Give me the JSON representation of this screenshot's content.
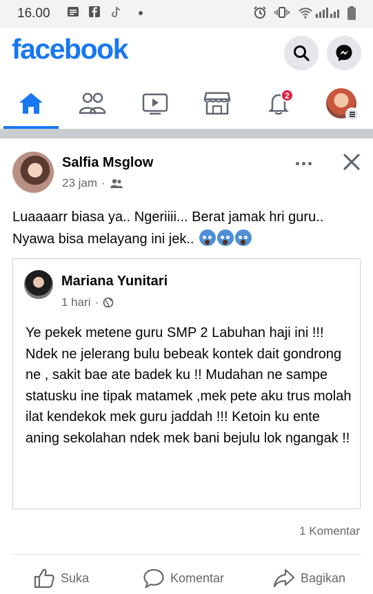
{
  "status_bar": {
    "time": "16.00"
  },
  "header": {
    "logo": "facebook",
    "search_icon": "search-icon",
    "messenger_icon": "messenger-icon"
  },
  "tabs": {
    "items": [
      "home",
      "friends",
      "watch",
      "marketplace",
      "notifications",
      "profile-menu"
    ],
    "notifications_badge": "2",
    "active": "home",
    "accent": "#1877f2"
  },
  "post": {
    "author": "Salfia Msglow",
    "time": "23 jam",
    "separator": "·",
    "audience_icon": "friends-icon",
    "text": "Luaaaarr biasa ya.. Ngeriiii... Berat jamak hri guru.. Nyawa bisa melayang ini jek..",
    "emoji": "😱😱😱",
    "shared": {
      "author": "Mariana Yunitari",
      "time": "1 hari",
      "separator": "·",
      "audience_icon": "public-globe-icon",
      "text": "Ye pekek metene guru SMP 2 Labuhan haji ini !!! Ndek ne jelerang bulu bebeak kontek dait gondrong ne , sakit bae ate badek ku !! Mudahan ne sampe statusku ine tipak matamek ,mek pete aku trus molah ilat kendekok mek guru jaddah !!! Ketoin ku ente aning sekolahan ndek mek bani bejulu lok ngangak !!"
    },
    "comment_count": "1 Komentar",
    "actions": {
      "like": "Suka",
      "comment": "Komentar",
      "share": "Bagikan"
    }
  }
}
